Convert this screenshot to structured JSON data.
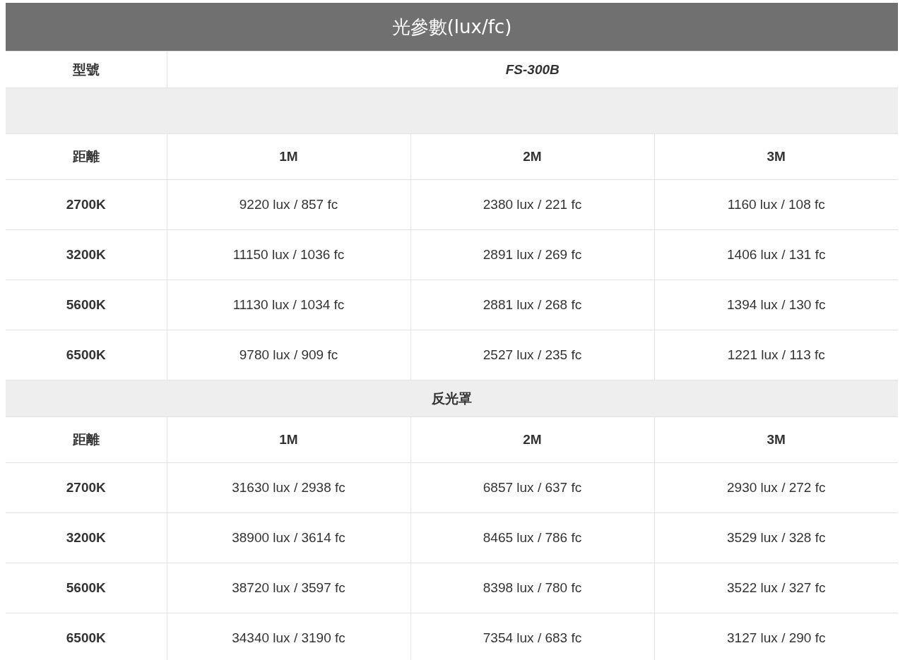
{
  "title": "光參數(lux/fc)",
  "model_row": {
    "label": "型號",
    "value": "FS-300B"
  },
  "sections": [
    {
      "header": {
        "label": "距離",
        "columns": [
          "1M",
          "2M",
          "3M"
        ]
      },
      "rows": [
        {
          "label": "2700K",
          "cells": [
            "9220 lux / 857 fc",
            "2380 lux / 221 fc",
            "1160 lux / 108 fc"
          ]
        },
        {
          "label": "3200K",
          "cells": [
            "11150 lux / 1036 fc",
            "2891 lux / 269 fc",
            "1406 lux / 131 fc"
          ]
        },
        {
          "label": "5600K",
          "cells": [
            "11130 lux / 1034 fc",
            "2881 lux / 268 fc",
            "1394 lux / 130 fc"
          ]
        },
        {
          "label": "6500K",
          "cells": [
            "9780 lux / 909 fc",
            "2527 lux / 235 fc",
            "1221 lux / 113 fc"
          ]
        }
      ]
    },
    {
      "heading": "反光罩",
      "header": {
        "label": "距離",
        "columns": [
          "1M",
          "2M",
          "3M"
        ]
      },
      "rows": [
        {
          "label": "2700K",
          "cells": [
            "31630 lux / 2938 fc",
            "6857 lux / 637 fc",
            "2930 lux / 272 fc"
          ]
        },
        {
          "label": "3200K",
          "cells": [
            "38900 lux / 3614 fc",
            "8465 lux / 786 fc",
            "3529 lux / 328 fc"
          ]
        },
        {
          "label": "5600K",
          "cells": [
            "38720 lux / 3597 fc",
            "8398 lux / 780 fc",
            "3522 lux / 327 fc"
          ]
        },
        {
          "label": "6500K",
          "cells": [
            "34340 lux / 3190 fc",
            "7354 lux / 683 fc",
            "3127 lux / 290 fc"
          ]
        }
      ]
    }
  ]
}
